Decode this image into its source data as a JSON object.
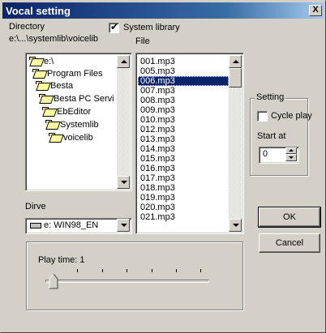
{
  "window": {
    "title": "Vocal setting",
    "close_glyph": "X"
  },
  "directory": {
    "label": "Directory",
    "path": "e:\\...\\systemlib\\voicelib",
    "tree": [
      {
        "label": "e:\\",
        "icon": "open-folder-icon"
      },
      {
        "label": "Program Files",
        "icon": "open-folder-icon"
      },
      {
        "label": "Besta",
        "icon": "open-folder-icon"
      },
      {
        "label": "Besta PC Servi",
        "icon": "open-folder-icon"
      },
      {
        "label": "EbEditor",
        "icon": "open-folder-icon"
      },
      {
        "label": "Systemlib",
        "icon": "open-folder-icon"
      },
      {
        "label": "voicelib",
        "icon": "open-folder-icon"
      }
    ]
  },
  "system_library": {
    "label": "System library",
    "checked": true
  },
  "file": {
    "label": "File",
    "items": [
      "001.mp3",
      "005.mp3",
      "006.mp3",
      "007.mp3",
      "008.mp3",
      "009.mp3",
      "010.mp3",
      "012.mp3",
      "013.mp3",
      "014.mp3",
      "015.mp3",
      "016.mp3",
      "017.mp3",
      "018.mp3",
      "019.mp3",
      "020.mp3",
      "021.mp3"
    ],
    "selected": "006.mp3"
  },
  "drive": {
    "label": "Dirve",
    "value": "e: WIN98_EN",
    "icon": "drive-icon"
  },
  "setting": {
    "label": "Setting",
    "cycle_play": {
      "label": "Cycle play",
      "checked": false
    },
    "start_at": {
      "label": "Start at",
      "value": "0"
    }
  },
  "buttons": {
    "ok": "OK",
    "cancel": "Cancel"
  },
  "play_time": {
    "label": "Play time: 1",
    "value": 1
  }
}
